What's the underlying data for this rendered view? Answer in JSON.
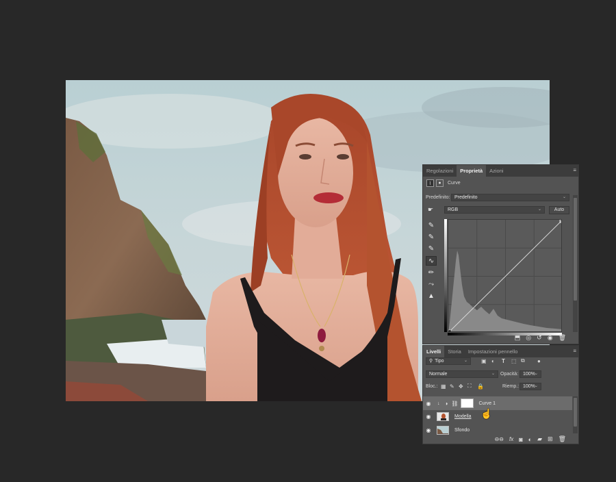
{
  "properties_panel": {
    "tabs": [
      {
        "label": "Regolazioni",
        "active": false
      },
      {
        "label": "Proprietà",
        "active": true
      },
      {
        "label": "Azioni",
        "active": false
      }
    ],
    "adjustment_title": "Curve",
    "preset_label": "Predefinito:",
    "preset_value": "Predefinito",
    "channel_value": "RGB",
    "auto_button": "Auto"
  },
  "layers_panel": {
    "tabs": [
      {
        "label": "Livelli",
        "active": true
      },
      {
        "label": "Storia",
        "active": false
      },
      {
        "label": "Impostazioni pennello",
        "active": false
      }
    ],
    "filter_kind": "Tipo",
    "blend_mode": "Normale",
    "opacity_label": "Opacità:",
    "opacity_value": "100%",
    "lock_label": "Bloc.:",
    "fill_label": "Riemp.:",
    "fill_value": "100%",
    "layers": [
      {
        "name": "Curve 1",
        "visible": true,
        "selected": true
      },
      {
        "name": "Modella",
        "visible": true,
        "selected": false
      },
      {
        "name": "Sfondo",
        "visible": true,
        "selected": false
      }
    ]
  },
  "colors": {
    "app_background": "#282828",
    "panel": "#535353",
    "tab_bar": "#3c3c3c",
    "selected_layer": "#6c6c6c"
  }
}
